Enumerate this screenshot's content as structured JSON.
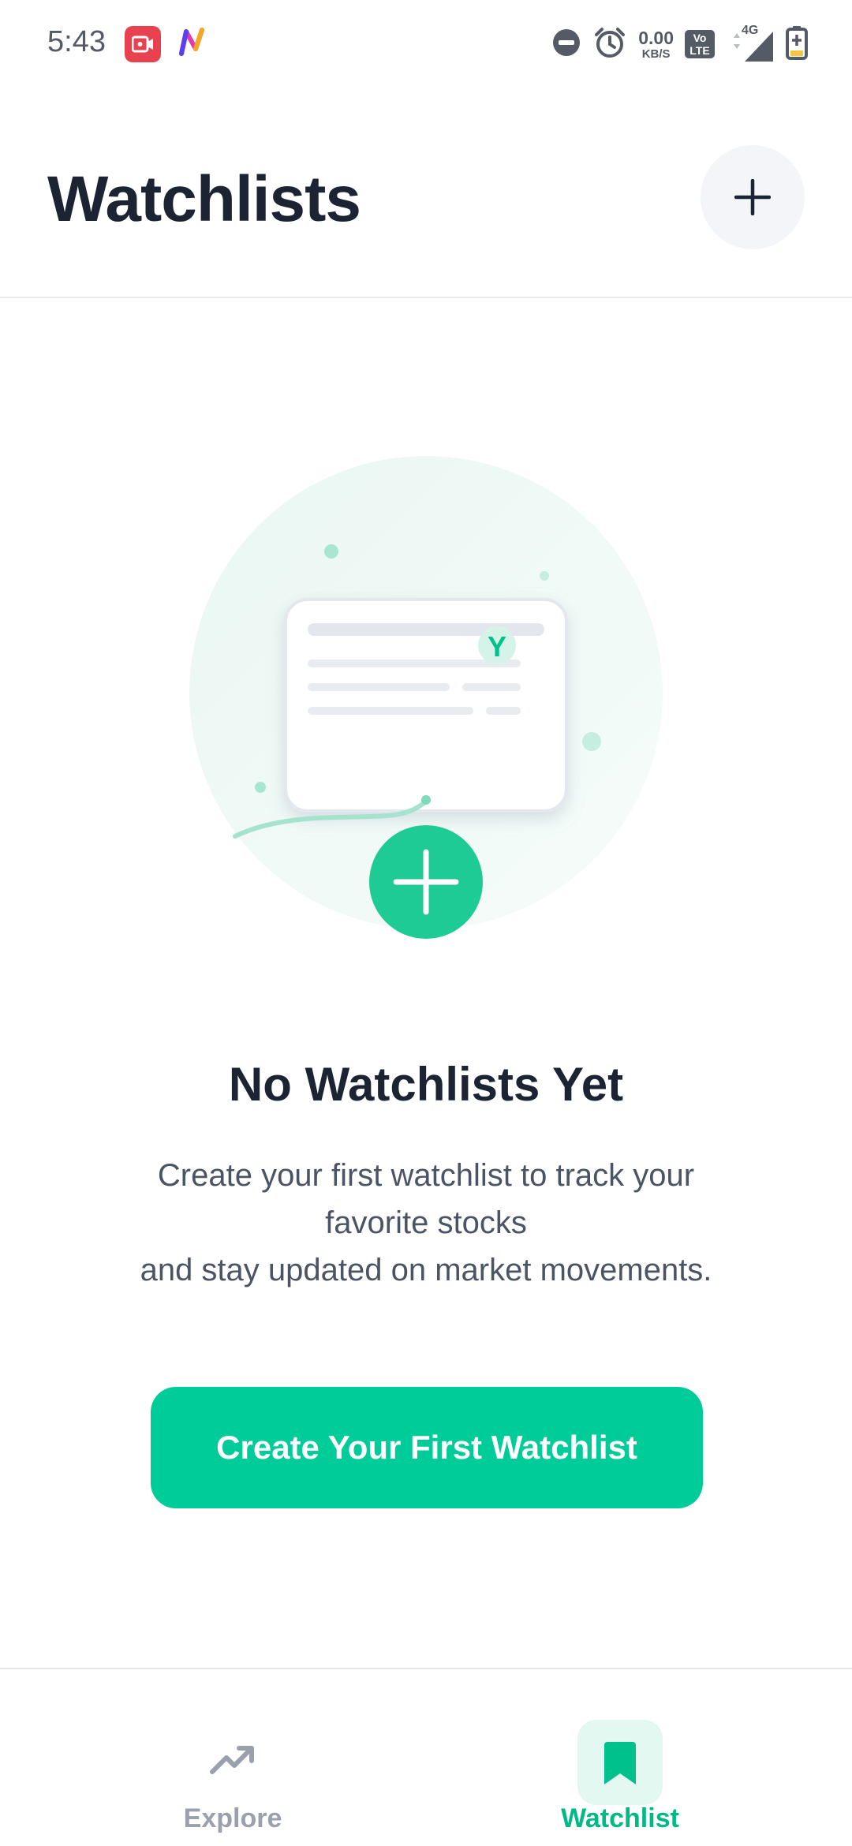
{
  "status_bar": {
    "time": "5:43",
    "network_speed_value": "0.00",
    "network_speed_unit": "KB/S",
    "volte_label": "Vo LTE",
    "network_type": "4G",
    "icons": [
      "screen-recorder-icon",
      "app-logo-icon",
      "do-not-disturb-icon",
      "alarm-icon",
      "signal-icon",
      "battery-charging-icon"
    ]
  },
  "header": {
    "title": "Watchlists",
    "add_icon": "plus-icon"
  },
  "empty_state": {
    "title": "No Watchlists Yet",
    "description_lines": [
      "Create your first watchlist to track your",
      "favorite stocks",
      "and stay updated on market movements."
    ],
    "cta_label": "Create Your First Watchlist",
    "illustration_badge": "Y"
  },
  "bottom_nav": {
    "items": [
      {
        "label": "Explore",
        "icon": "trending-up-icon",
        "active": false
      },
      {
        "label": "Watchlist",
        "icon": "bookmark-icon",
        "active": true
      }
    ]
  },
  "colors": {
    "accent": "#00CC99",
    "title_text": "#1C2434",
    "body_text": "#4B5465",
    "inactive_nav": "#9AA1AD"
  }
}
